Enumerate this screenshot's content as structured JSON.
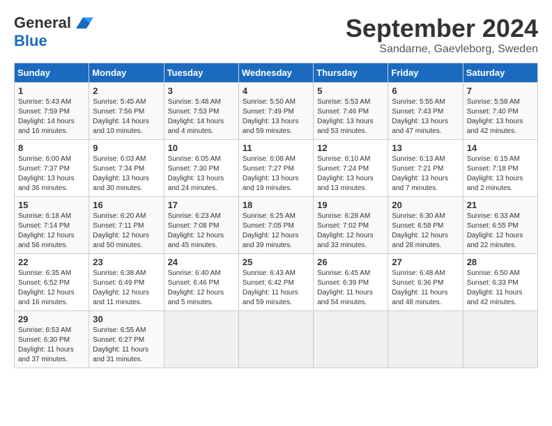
{
  "header": {
    "logo_general": "General",
    "logo_blue": "Blue",
    "title": "September 2024",
    "subtitle": "Sandarne, Gaevleborg, Sweden"
  },
  "calendar": {
    "days_of_week": [
      "Sunday",
      "Monday",
      "Tuesday",
      "Wednesday",
      "Thursday",
      "Friday",
      "Saturday"
    ],
    "weeks": [
      [
        {
          "day": "1",
          "info": "Sunrise: 5:43 AM\nSunset: 7:59 PM\nDaylight: 14 hours\nand 16 minutes."
        },
        {
          "day": "2",
          "info": "Sunrise: 5:45 AM\nSunset: 7:56 PM\nDaylight: 14 hours\nand 10 minutes."
        },
        {
          "day": "3",
          "info": "Sunrise: 5:48 AM\nSunset: 7:53 PM\nDaylight: 14 hours\nand 4 minutes."
        },
        {
          "day": "4",
          "info": "Sunrise: 5:50 AM\nSunset: 7:49 PM\nDaylight: 13 hours\nand 59 minutes."
        },
        {
          "day": "5",
          "info": "Sunrise: 5:53 AM\nSunset: 7:46 PM\nDaylight: 13 hours\nand 53 minutes."
        },
        {
          "day": "6",
          "info": "Sunrise: 5:55 AM\nSunset: 7:43 PM\nDaylight: 13 hours\nand 47 minutes."
        },
        {
          "day": "7",
          "info": "Sunrise: 5:58 AM\nSunset: 7:40 PM\nDaylight: 13 hours\nand 42 minutes."
        }
      ],
      [
        {
          "day": "8",
          "info": "Sunrise: 6:00 AM\nSunset: 7:37 PM\nDaylight: 13 hours\nand 36 minutes."
        },
        {
          "day": "9",
          "info": "Sunrise: 6:03 AM\nSunset: 7:34 PM\nDaylight: 13 hours\nand 30 minutes."
        },
        {
          "day": "10",
          "info": "Sunrise: 6:05 AM\nSunset: 7:30 PM\nDaylight: 13 hours\nand 24 minutes."
        },
        {
          "day": "11",
          "info": "Sunrise: 6:08 AM\nSunset: 7:27 PM\nDaylight: 13 hours\nand 19 minutes."
        },
        {
          "day": "12",
          "info": "Sunrise: 6:10 AM\nSunset: 7:24 PM\nDaylight: 13 hours\nand 13 minutes."
        },
        {
          "day": "13",
          "info": "Sunrise: 6:13 AM\nSunset: 7:21 PM\nDaylight: 13 hours\nand 7 minutes."
        },
        {
          "day": "14",
          "info": "Sunrise: 6:15 AM\nSunset: 7:18 PM\nDaylight: 13 hours\nand 2 minutes."
        }
      ],
      [
        {
          "day": "15",
          "info": "Sunrise: 6:18 AM\nSunset: 7:14 PM\nDaylight: 12 hours\nand 56 minutes."
        },
        {
          "day": "16",
          "info": "Sunrise: 6:20 AM\nSunset: 7:11 PM\nDaylight: 12 hours\nand 50 minutes."
        },
        {
          "day": "17",
          "info": "Sunrise: 6:23 AM\nSunset: 7:08 PM\nDaylight: 12 hours\nand 45 minutes."
        },
        {
          "day": "18",
          "info": "Sunrise: 6:25 AM\nSunset: 7:05 PM\nDaylight: 12 hours\nand 39 minutes."
        },
        {
          "day": "19",
          "info": "Sunrise: 6:28 AM\nSunset: 7:02 PM\nDaylight: 12 hours\nand 33 minutes."
        },
        {
          "day": "20",
          "info": "Sunrise: 6:30 AM\nSunset: 6:58 PM\nDaylight: 12 hours\nand 28 minutes."
        },
        {
          "day": "21",
          "info": "Sunrise: 6:33 AM\nSunset: 6:55 PM\nDaylight: 12 hours\nand 22 minutes."
        }
      ],
      [
        {
          "day": "22",
          "info": "Sunrise: 6:35 AM\nSunset: 6:52 PM\nDaylight: 12 hours\nand 16 minutes."
        },
        {
          "day": "23",
          "info": "Sunrise: 6:38 AM\nSunset: 6:49 PM\nDaylight: 12 hours\nand 11 minutes."
        },
        {
          "day": "24",
          "info": "Sunrise: 6:40 AM\nSunset: 6:46 PM\nDaylight: 12 hours\nand 5 minutes."
        },
        {
          "day": "25",
          "info": "Sunrise: 6:43 AM\nSunset: 6:42 PM\nDaylight: 11 hours\nand 59 minutes."
        },
        {
          "day": "26",
          "info": "Sunrise: 6:45 AM\nSunset: 6:39 PM\nDaylight: 11 hours\nand 54 minutes."
        },
        {
          "day": "27",
          "info": "Sunrise: 6:48 AM\nSunset: 6:36 PM\nDaylight: 11 hours\nand 48 minutes."
        },
        {
          "day": "28",
          "info": "Sunrise: 6:50 AM\nSunset: 6:33 PM\nDaylight: 11 hours\nand 42 minutes."
        }
      ],
      [
        {
          "day": "29",
          "info": "Sunrise: 6:53 AM\nSunset: 6:30 PM\nDaylight: 11 hours\nand 37 minutes."
        },
        {
          "day": "30",
          "info": "Sunrise: 6:55 AM\nSunset: 6:27 PM\nDaylight: 11 hours\nand 31 minutes."
        },
        {
          "day": "",
          "info": ""
        },
        {
          "day": "",
          "info": ""
        },
        {
          "day": "",
          "info": ""
        },
        {
          "day": "",
          "info": ""
        },
        {
          "day": "",
          "info": ""
        }
      ]
    ]
  }
}
